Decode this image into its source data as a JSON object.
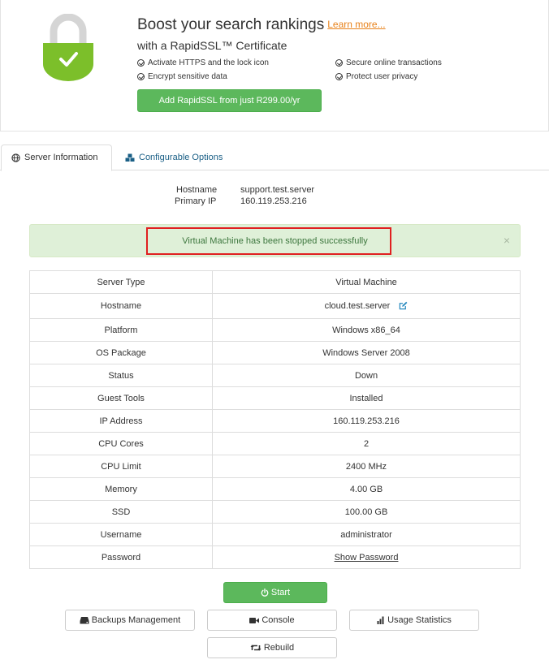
{
  "promo": {
    "title": "Boost your search rankings",
    "learn_more": "Learn more...",
    "subtitle": "with a RapidSSL™ Certificate",
    "features": [
      "Activate HTTPS and the lock icon",
      "Secure online transactions",
      "Encrypt sensitive data",
      "Protect user privacy"
    ],
    "button": "Add RapidSSL from just R299.00/yr"
  },
  "tabs": {
    "server_info": "Server Information",
    "config_options": "Configurable Options"
  },
  "host": {
    "hostname_label": "Hostname",
    "hostname_value": "support.test.server",
    "ip_label": "Primary IP",
    "ip_value": "160.119.253.216"
  },
  "alert": {
    "message": "Virtual Machine has been stopped successfully",
    "close": "×"
  },
  "details": [
    {
      "label": "Server Type",
      "value": "Virtual Machine"
    },
    {
      "label": "Hostname",
      "value": "cloud.test.server"
    },
    {
      "label": "Platform",
      "value": "Windows x86_64"
    },
    {
      "label": "OS Package",
      "value": "Windows Server 2008"
    },
    {
      "label": "Status",
      "value": "Down"
    },
    {
      "label": "Guest Tools",
      "value": "Installed"
    },
    {
      "label": "IP Address",
      "value": "160.119.253.216"
    },
    {
      "label": "CPU Cores",
      "value": "2"
    },
    {
      "label": "CPU Limit",
      "value": "2400 MHz"
    },
    {
      "label": "Memory",
      "value": "4.00 GB"
    },
    {
      "label": "SSD",
      "value": "100.00 GB"
    },
    {
      "label": "Username",
      "value": "administrator"
    },
    {
      "label": "Password",
      "value": "Show Password"
    }
  ],
  "actions": {
    "start": "Start",
    "backups": "Backups Management",
    "console": "Console",
    "usage": "Usage Statistics",
    "rebuild": "Rebuild"
  },
  "colors": {
    "primary_green": "#5cb85c",
    "link_orange": "#e8821b",
    "tab_link": "#1a5f86",
    "alert_bg": "#dff0d8",
    "alert_text": "#3c763d",
    "status_down": "#a94442",
    "highlight": "#e02020"
  }
}
